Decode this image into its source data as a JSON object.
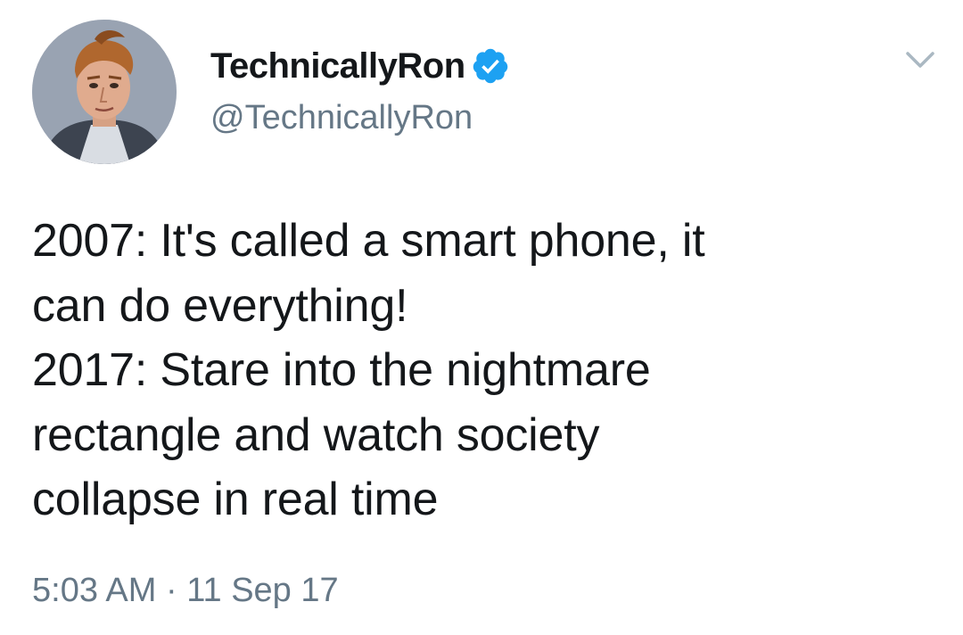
{
  "author": {
    "display_name": "TechnicallyRon",
    "handle": "@TechnicallyRon",
    "verified_icon": "verified-badge-icon",
    "avatar_icon": "avatar-illustration"
  },
  "menu": {
    "caret_icon": "chevron-down-icon"
  },
  "tweet": {
    "lines": [
      "2007: It's called a smart phone, it",
      "can do everything!",
      "2017: Stare into the nightmare",
      "rectangle and watch society",
      "collapse in real time"
    ],
    "timestamp": "5:03 AM · 11 Sep 17"
  },
  "colors": {
    "text": "#14171a",
    "secondary": "#657786",
    "verified": "#1da1f2",
    "background": "#ffffff"
  }
}
